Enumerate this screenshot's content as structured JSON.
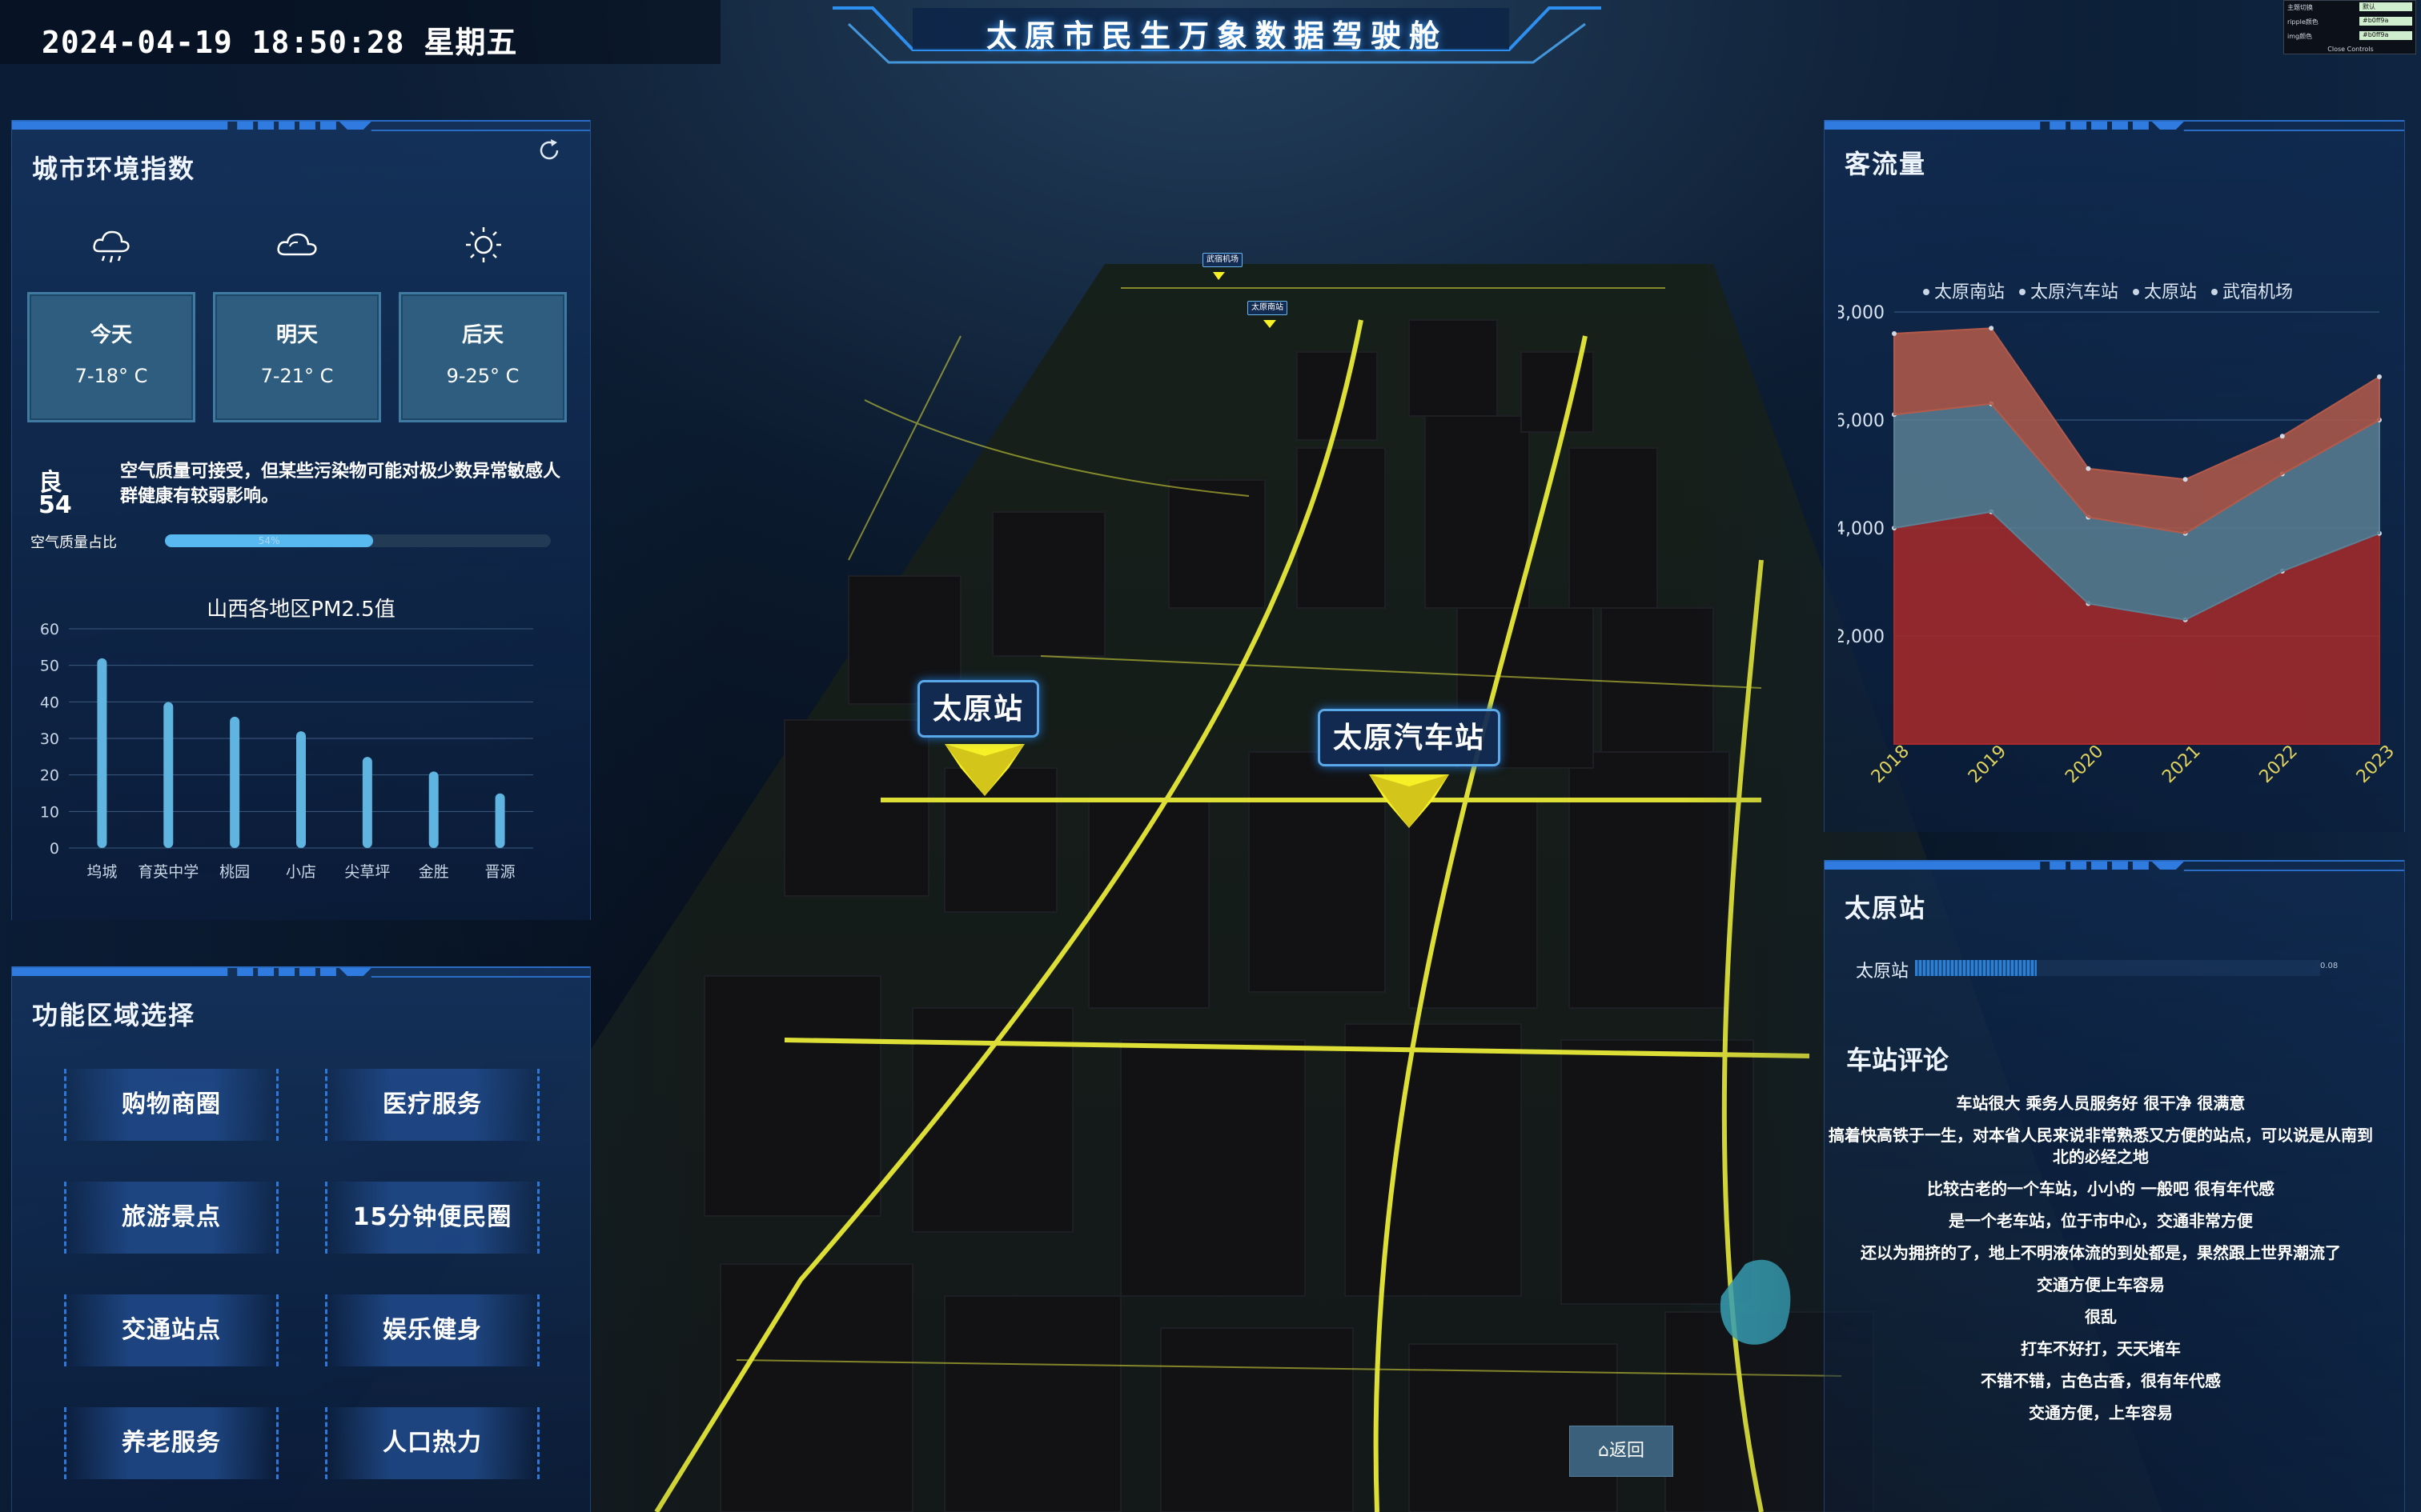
{
  "header": {
    "datetime": "2024-04-19 18:50:28 星期五",
    "title": "太原市民生万象数据驾驶舱"
  },
  "debug_panel": {
    "rows": [
      {
        "label": "主题切换",
        "value": "默认"
      },
      {
        "label": "ripple颜色",
        "value": "#b0ff9a"
      },
      {
        "label": "img颜色",
        "value": "#b0ff9a"
      }
    ],
    "close": "Close Controls"
  },
  "env_panel": {
    "title": "城市环境指数",
    "days": [
      {
        "name": "今天",
        "temp": "7-18° C",
        "icon": "rain-cloud-icon"
      },
      {
        "name": "明天",
        "temp": "7-21° C",
        "icon": "cloud-icon"
      },
      {
        "name": "后天",
        "temp": "9-25° C",
        "icon": "sun-icon"
      }
    ],
    "aqi_level": "良",
    "aqi_value": "54",
    "aqi_desc": "空气质量可接受，但某些污染物可能对极少数异常敏感人群健康有较弱影响。",
    "aqi_ratio_label": "空气质量占比",
    "aqi_ratio_text": "54%",
    "aqi_ratio": 0.54
  },
  "pm_chart": {
    "chart_data": {
      "type": "bar",
      "title": "山西各地区PM2.5值",
      "categories": [
        "坞城",
        "育英中学",
        "桃园",
        "小店",
        "尖草坪",
        "金胜",
        "晋源"
      ],
      "values": [
        55,
        43,
        39,
        35,
        28,
        24,
        18
      ],
      "ylim": [
        0,
        60
      ],
      "yticks": [
        "0",
        "10",
        "20",
        "30",
        "40",
        "50",
        "60"
      ],
      "color": "#5fb4e0"
    }
  },
  "func_panel": {
    "title": "功能区域选择",
    "buttons": [
      "购物商圈",
      "医疗服务",
      "旅游景点",
      "15分钟便民圈",
      "交通站点",
      "娱乐健身",
      "养老服务",
      "人口热力"
    ]
  },
  "flow_panel": {
    "title": "客流量",
    "chart_data": {
      "type": "area",
      "x": [
        "2018",
        "2019",
        "2020",
        "2021",
        "2022",
        "2023"
      ],
      "series": [
        {
          "name": "太原南站",
          "values": [
            4000,
            4300,
            2600,
            2300,
            3200,
            3900
          ],
          "color": "#a82a2a"
        },
        {
          "name": "太原汽车站",
          "values": [
            2100,
            2000,
            1600,
            1600,
            1800,
            2100
          ],
          "color": "#5b7f93"
        },
        {
          "name": "太原站",
          "values": [
            1500,
            1400,
            900,
            1000,
            700,
            800
          ],
          "color": "#b35a4a"
        },
        {
          "name": "武宿机场",
          "values": [
            0,
            0,
            0,
            0,
            0,
            0
          ],
          "color": "#8a7a3a"
        }
      ],
      "yticks": [
        "2,000",
        "4,000",
        "6,000",
        "8,000"
      ],
      "ylim": [
        0,
        8000
      ],
      "legend": "top"
    }
  },
  "station_panel": {
    "title": "太原站",
    "bar_label": "太原站",
    "bar_value": "0.08",
    "bar_ratio": 0.3,
    "review_title": "车站评论",
    "reviews": [
      "车站很大 乘务人员服务好 很干净 很满意",
      "搞着快高铁于一生，对本省人民来说非常熟悉又方便的站点，可以说是从南到北的必经之地",
      "比较古老的一个车站，小小的 一般吧 很有年代感",
      "是一个老车站，位于市中心，交通非常方便",
      "还以为拥挤的了，地上不明液体流的到处都是，果然跟上世界潮流了",
      "交通方便上车容易",
      "很乱",
      "打车不好打，天天堵车",
      "不错不错，古色古香，很有年代感",
      "交通方便，上车容易"
    ]
  },
  "map": {
    "labels": [
      "太原站",
      "太原汽车站"
    ],
    "mini_labels": [
      "武宿机场",
      "太原南站"
    ],
    "back_button": "返回"
  }
}
